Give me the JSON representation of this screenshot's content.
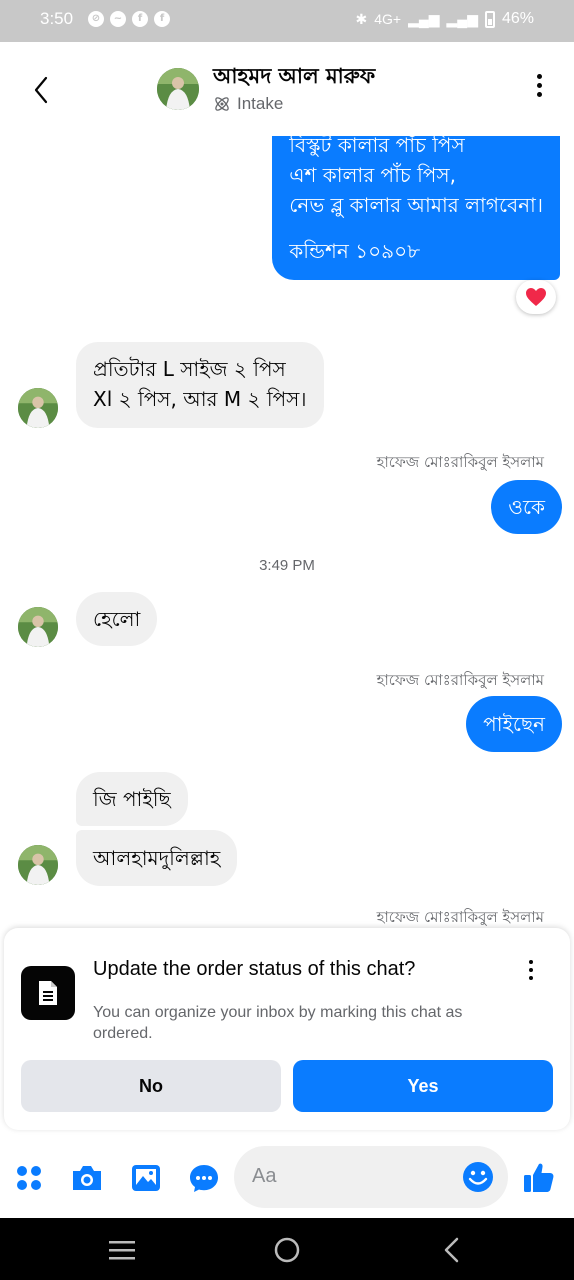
{
  "status_bar": {
    "time": "3:50",
    "network": "4G+",
    "battery": "46%"
  },
  "header": {
    "contact_name": "আহমদ আল মারুফ",
    "subtitle": "Intake"
  },
  "messages": {
    "outgoing_1": {
      "line1": "বিস্কুট কালার পাঁচ পিস",
      "line2": "এশ কালার পাঁচ পিস,",
      "line3": "নেভ ব্লু কালার আমার লাগবেনা।",
      "line4": "কন্ডিশন ১০৯০৮"
    },
    "reaction": "heart",
    "incoming_1": {
      "line1": "প্রতিটার L সাইজ ২ পিস",
      "line2": "Xl ২ পিস, আর M ২ পিস।"
    },
    "sender_1": "হাফেজ মোঃরাকিবুল ইসলাম",
    "outgoing_2": "ওকে",
    "timestamp": "3:49 PM",
    "incoming_2": "হেলো",
    "sender_2": "হাফেজ মোঃরাকিবুল ইসলাম",
    "outgoing_3": "পাইছেন",
    "incoming_3": "জি পাইছি",
    "incoming_4": "আলহামদুলিল্লাহ",
    "sender_3": "হাফেজ মোঃরাকিবুল ইসলাম"
  },
  "order_card": {
    "title": "Update the order status of this chat?",
    "description": "You can organize your inbox by marking this chat as ordered.",
    "no_label": "No",
    "yes_label": "Yes"
  },
  "composer": {
    "placeholder": "Aa"
  },
  "colors": {
    "accent": "#0a7cff",
    "incoming_bubble": "#f0f0f0",
    "status_bar": "#c8c8c8"
  }
}
